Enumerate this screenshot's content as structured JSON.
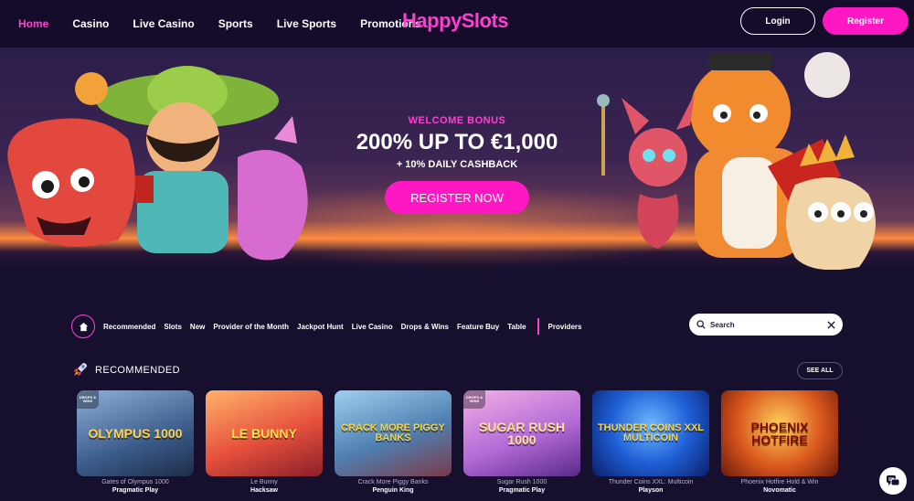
{
  "header": {
    "nav": [
      "Home",
      "Casino",
      "Live Casino",
      "Sports",
      "Live Sports",
      "Promotions"
    ],
    "logo_a": "H",
    "logo_b": "appy",
    "logo_c": "Slots",
    "login": "Login",
    "register": "Register"
  },
  "hero": {
    "welcome": "WELCOME BONUS",
    "bonus": "200% UP TO €1,000",
    "cashback": "+ 10% DAILY CASHBACK",
    "cta": "REGISTER NOW"
  },
  "categories": [
    "Recommended",
    "Slots",
    "New",
    "Provider of the Month",
    "Jackpot Hunt",
    "Live Casino",
    "Drops & Wins",
    "Feature Buy",
    "Table"
  ],
  "providers_label": "Providers",
  "search": {
    "placeholder": "Search"
  },
  "section": {
    "title": "RECOMMENDED",
    "see_all": "SEE ALL"
  },
  "games": [
    {
      "title": "Gates of Olympus 1000",
      "provider": "Pragmatic Play",
      "art": "OLYMPUS 1000",
      "badge": "DROPS & WINS",
      "color": "#3b5b8a"
    },
    {
      "title": "Le Bunny",
      "provider": "Hacksaw",
      "art": "LE BUNNY",
      "badge": "",
      "color": "#e6503c"
    },
    {
      "title": "Crack More Piggy Banks",
      "provider": "Penguin King",
      "art": "CRACK MORE PIGGY BANKS",
      "badge": "",
      "color": "#4f7fb0"
    },
    {
      "title": "Sugar Rush 1000",
      "provider": "Pragmatic Play",
      "art": "SUGAR RUSH 1000",
      "badge": "DROPS & WINS",
      "color": "#b46ad6"
    },
    {
      "title": "Thunder Coins XXL: Multicoin",
      "provider": "Playson",
      "art": "THUNDER COINS XXL MULTICOIN",
      "badge": "",
      "color": "#1f5fd6"
    },
    {
      "title": "Phoenix Hotfire Hold & Win",
      "provider": "Novomatic",
      "art": "PHOENIX HOTFIRE",
      "badge": "",
      "color": "#d8561c"
    }
  ],
  "colors": {
    "accent": "#ff17c4",
    "bg": "#170f2e"
  }
}
